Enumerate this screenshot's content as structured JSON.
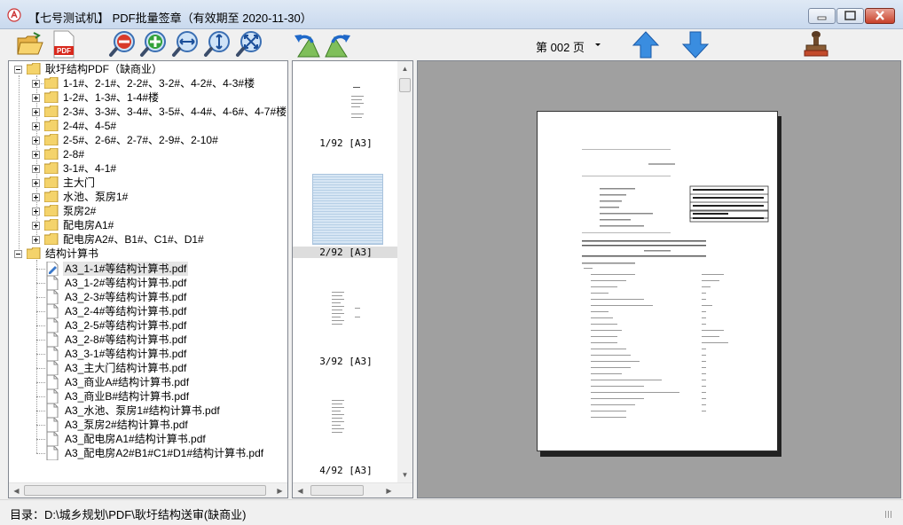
{
  "window": {
    "title": "【七号测试机】 PDF批量签章（有效期至 2020-11-30）"
  },
  "toolbar": {
    "icons": [
      "open-folder-icon",
      "pdf-icon",
      "zoom-out-icon",
      "zoom-in-icon",
      "fit-width-icon",
      "fit-height-icon",
      "fit-page-icon",
      "rotate-left-icon",
      "rotate-right-icon",
      "page-up-icon",
      "page-down-icon",
      "stamp-icon"
    ],
    "page_label": "第 002 页"
  },
  "tree": {
    "root1": "耿圩结构PDF（缺商业）",
    "folders": [
      "1-1#、2-1#、2-2#、3-2#、4-2#、4-3#楼",
      "1-2#、1-3#、1-4#楼",
      "2-3#、3-3#、3-4#、3-5#、4-4#、4-6#、4-7#楼",
      "2-4#、4-5#",
      "2-5#、2-6#、2-7#、2-9#、2-10#",
      "2-8#",
      "3-1#、4-1#",
      "主大门",
      "水池、泵房1#",
      "泵房2#",
      "配电房A1#",
      "配电房A2#、B1#、C1#、D1#"
    ],
    "root2": "结构计算书",
    "files": [
      "A3_1-1#等结构计算书.pdf",
      "A3_1-2#等结构计算书.pdf",
      "A3_2-3#等结构计算书.pdf",
      "A3_2-4#等结构计算书.pdf",
      "A3_2-5#等结构计算书.pdf",
      "A3_2-8#等结构计算书.pdf",
      "A3_3-1#等结构计算书.pdf",
      "A3_主大门结构计算书.pdf",
      "A3_商业A#结构计算书.pdf",
      "A3_商业B#结构计算书.pdf",
      "A3_水池、泵房1#结构计算书.pdf",
      "A3_泵房2#结构计算书.pdf",
      "A3_配电房A1#结构计算书.pdf",
      "A3_配电房A2#B1#C1#D1#结构计算书.pdf"
    ]
  },
  "thumbnails": [
    {
      "label": "1/92 [A3]"
    },
    {
      "label": "2/92 [A3]"
    },
    {
      "label": "3/92 [A3]"
    },
    {
      "label": "4/92 [A3]"
    }
  ],
  "status": {
    "text": "目录：D:\\城乡规划\\PDF\\耿圩结构送审(缺商业)"
  },
  "colors": {
    "folder": "#f4d36b",
    "arrow_blue": "#2f7fd8",
    "zoom_red": "#d83a2a",
    "zoom_green": "#33a23a",
    "preview_bg": "#a0a0a0"
  }
}
